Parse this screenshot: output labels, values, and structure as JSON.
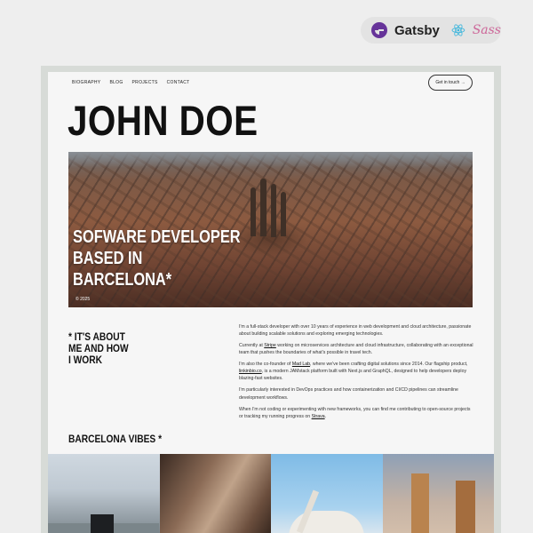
{
  "badge": {
    "gatsby_label": "Gatsby",
    "sass_label": "Sass",
    "gatsby_color": "#663399",
    "react_color": "#61dafb",
    "sass_color": "#cd6799"
  },
  "nav": {
    "links": [
      "BIOGRAPHY",
      "BLOG",
      "PROJECTS",
      "CONTACT"
    ],
    "cta_label": "Get in touch →"
  },
  "hero": {
    "title": "JOHN DOE",
    "caption_lines": [
      "SOFWARE DEVELOPER",
      "BASED IN",
      "BARCELONA*"
    ],
    "copyright": "© 2025"
  },
  "about": {
    "title_lines": [
      "* IT'S ABOUT",
      "ME AND HOW",
      "I WORK"
    ],
    "p1": "I'm a full-stack developer with over 10 years of experience in web development and cloud architecture, passionate about building scalable solutions and exploring emerging technologies.",
    "p2_before": "Currently at ",
    "p2_link": "Stripe",
    "p2_after": " working on microservices architecture and cloud infrastructure, collaborating with an exceptional team that pushes the boundaries of what's possible in travel tech.",
    "p3_before": "I'm also the co-founder of ",
    "p3_link1": "Mad Lab",
    "p3_middle": ", where we've been crafting digital solutions since 2014. Our flagship product, ",
    "p3_link2": "linkinbio.co",
    "p3_after": ", is a modern JAMstack platform built with Next.js and GraphQL, designed to help developers deploy blazing-fast websites.",
    "p4": "I'm particularly interested in DevOps practices and how containerization and CI/CD pipelines can streamline development workflows.",
    "p5_before": "When I'm not coding or experimenting with new frameworks, you can find me contributing to open-source projects or tracking my running progress on ",
    "p5_link": "Strava",
    "p5_after": "."
  },
  "vibes": {
    "title": "BARCELONA VIBES *"
  }
}
